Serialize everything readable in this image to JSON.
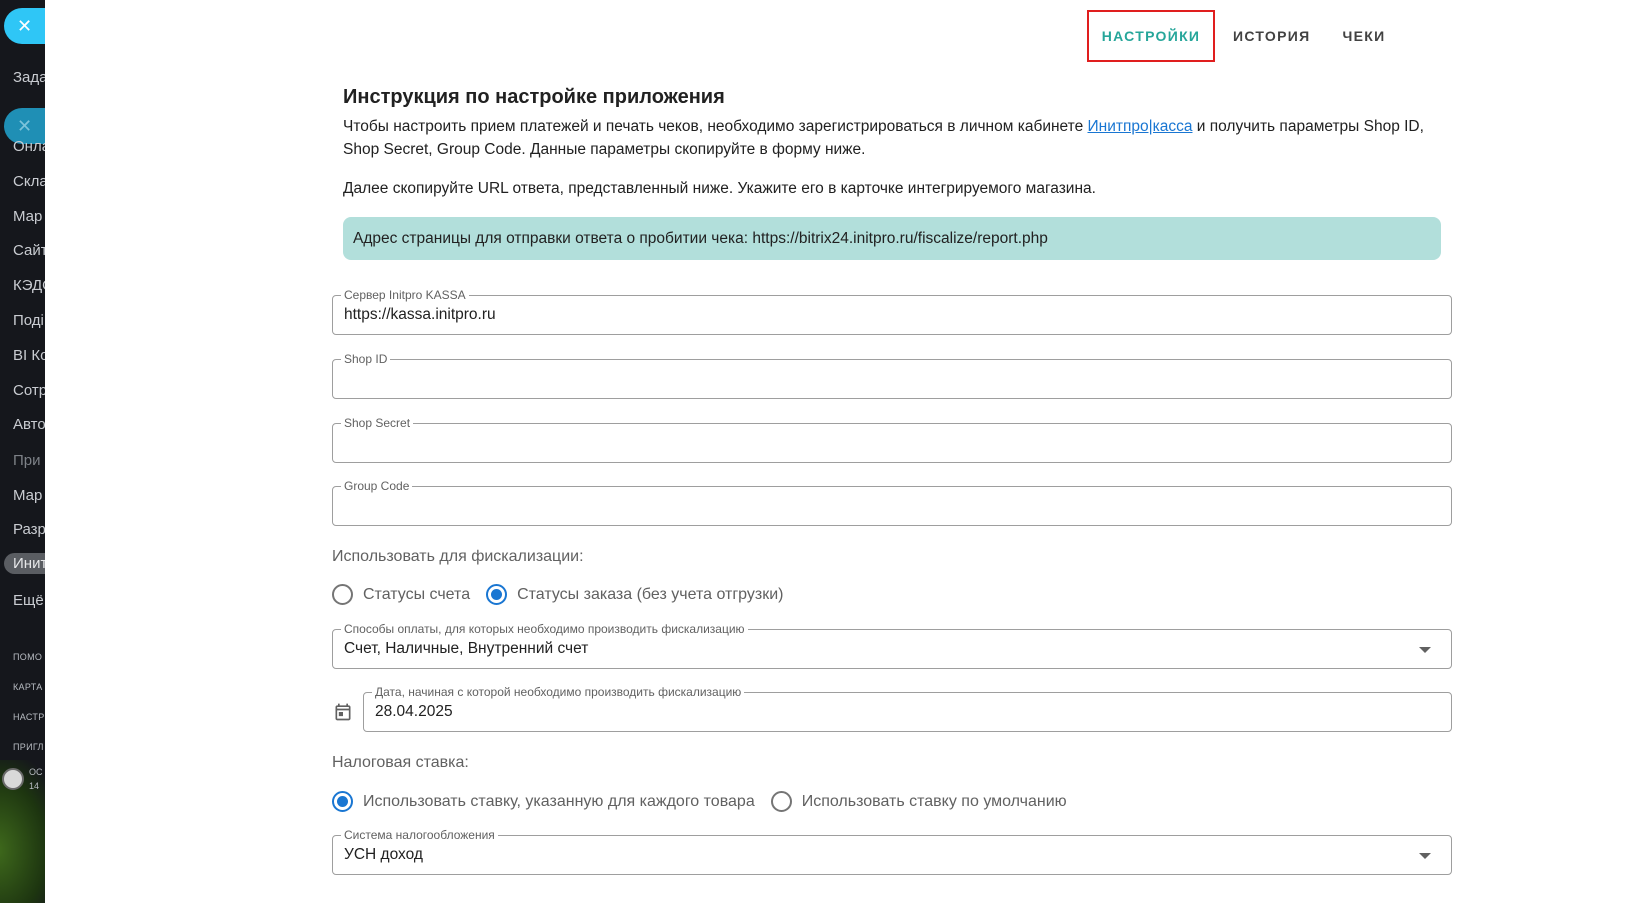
{
  "background_sidebar": {
    "items": [
      {
        "label": "Зада",
        "style": "normal"
      },
      {
        "label": "Онла",
        "style": "normal"
      },
      {
        "label": "Скла",
        "style": "normal"
      },
      {
        "label": "Мар",
        "style": "normal"
      },
      {
        "label": "Сайт",
        "style": "normal"
      },
      {
        "label": "КЭДО",
        "style": "normal"
      },
      {
        "label": "Поді",
        "style": "normal"
      },
      {
        "label": "BI Ко",
        "style": "normal"
      },
      {
        "label": "Сотр",
        "style": "normal"
      },
      {
        "label": "Авто",
        "style": "normal"
      },
      {
        "label": "При",
        "style": "dim"
      },
      {
        "label": "Мар",
        "style": "normal"
      },
      {
        "label": "Разр",
        "style": "normal"
      },
      {
        "label": "Инит",
        "style": "active"
      },
      {
        "label": "Ещё",
        "style": "normal"
      },
      {
        "label": "ПОМО",
        "style": "small"
      },
      {
        "label": "КАРТА",
        "style": "small"
      },
      {
        "label": "НАСТР",
        "style": "small"
      },
      {
        "label": "ПРИГЛ",
        "style": "small"
      }
    ],
    "user": {
      "line1": "ОС",
      "line2": "14"
    },
    "close_icon": "close-icon"
  },
  "tabs": [
    {
      "label": "НАСТРОЙКИ",
      "active": true
    },
    {
      "label": "ИСТОРИЯ",
      "active": false
    },
    {
      "label": "ЧЕКИ",
      "active": false
    }
  ],
  "instructions": {
    "title": "Инструкция по настройке приложения",
    "para1_before": "Чтобы настроить прием платежей и печать чеков, необходимо зарегистрироваться в личном кабинете ",
    "para1_link": "Инитпро|касса",
    "para1_after": " и получить параметры Shop ID, Shop Secret, Group Code. Данные параметры скопируйте в форму ниже.",
    "para2": "Далее скопируйте URL ответа, представленный ниже. Укажите его в карточке интегрируемого магазина.",
    "alert": "Адрес страницы для отправки ответа о пробитии чека: https://bitrix24.initpro.ru/fiscalize/report.php"
  },
  "form": {
    "server": {
      "label": "Сервер Initpro KASSA",
      "value": "https://kassa.initpro.ru"
    },
    "shop_id": {
      "label": "Shop ID",
      "value": ""
    },
    "shop_secret": {
      "label": "Shop Secret",
      "value": ""
    },
    "group_code": {
      "label": "Group Code",
      "value": ""
    },
    "fiscal_use": {
      "label": "Использовать для фискализации:",
      "options": [
        {
          "label": "Статусы счета",
          "checked": false
        },
        {
          "label": "Статусы заказа (без учета отгрузки)",
          "checked": true
        }
      ]
    },
    "payment_methods": {
      "label": "Способы оплаты, для которых необходимо производить фискализацию",
      "value": "Счет, Наличные, Внутренний счет"
    },
    "start_date": {
      "label": "Дата, начиная с которой необходимо производить фискализацию",
      "value": "28.04.2025"
    },
    "tax_rate": {
      "label": "Налоговая ставка:",
      "options": [
        {
          "label": "Использовать ставку, указанную для каждого товара",
          "checked": true
        },
        {
          "label": "Использовать ставку по умолчанию",
          "checked": false
        }
      ]
    },
    "tax_system": {
      "label": "Система налогообложения",
      "value": "УСН доход"
    }
  },
  "colors": {
    "accent": "#26a69a",
    "highlight_border": "#e01e1e",
    "alert_bg": "#b2dfdb",
    "radio_checked": "#1976d2",
    "link": "#1976d2"
  }
}
